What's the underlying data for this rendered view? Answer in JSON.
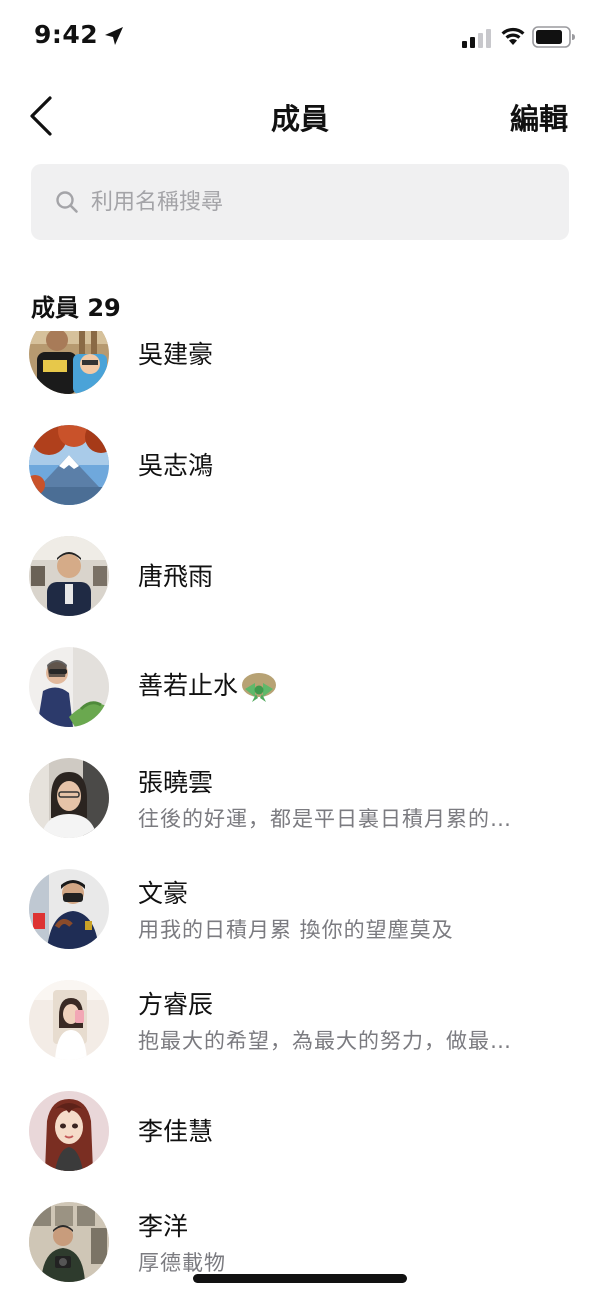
{
  "status_bar": {
    "time": "9:42"
  },
  "nav": {
    "title": "成員",
    "edit_label": "編輯"
  },
  "search": {
    "placeholder": "利用名稱搜尋",
    "value": ""
  },
  "section": {
    "title": "成員 29"
  },
  "members": [
    {
      "name": "吳建豪",
      "bio": "",
      "avatar": "man-shirt-cartoon-avatar"
    },
    {
      "name": "吳志鴻",
      "bio": "",
      "avatar": "mount-fuji-autumn-leaves"
    },
    {
      "name": "唐飛雨",
      "bio": "",
      "avatar": "man-suit-office"
    },
    {
      "name": "善若止水",
      "bio": "",
      "avatar": "woman-sunglasses-leaves",
      "emoji": "green-bow"
    },
    {
      "name": "張曉雲",
      "bio": "往後的好運，都是平日裏日積月累的…",
      "avatar": "woman-glasses-portrait"
    },
    {
      "name": "文豪",
      "bio": "用我的日積月累 換你的望塵莫及",
      "avatar": "police-officer-mask"
    },
    {
      "name": "方睿辰",
      "bio": "抱最大的希望，為最大的努力，做最…",
      "avatar": "woman-selfie-room"
    },
    {
      "name": "李佳慧",
      "bio": "",
      "avatar": "anime-girl-illustration"
    },
    {
      "name": "李洋",
      "bio": "厚德載物",
      "avatar": "man-camera-shelf"
    }
  ]
}
